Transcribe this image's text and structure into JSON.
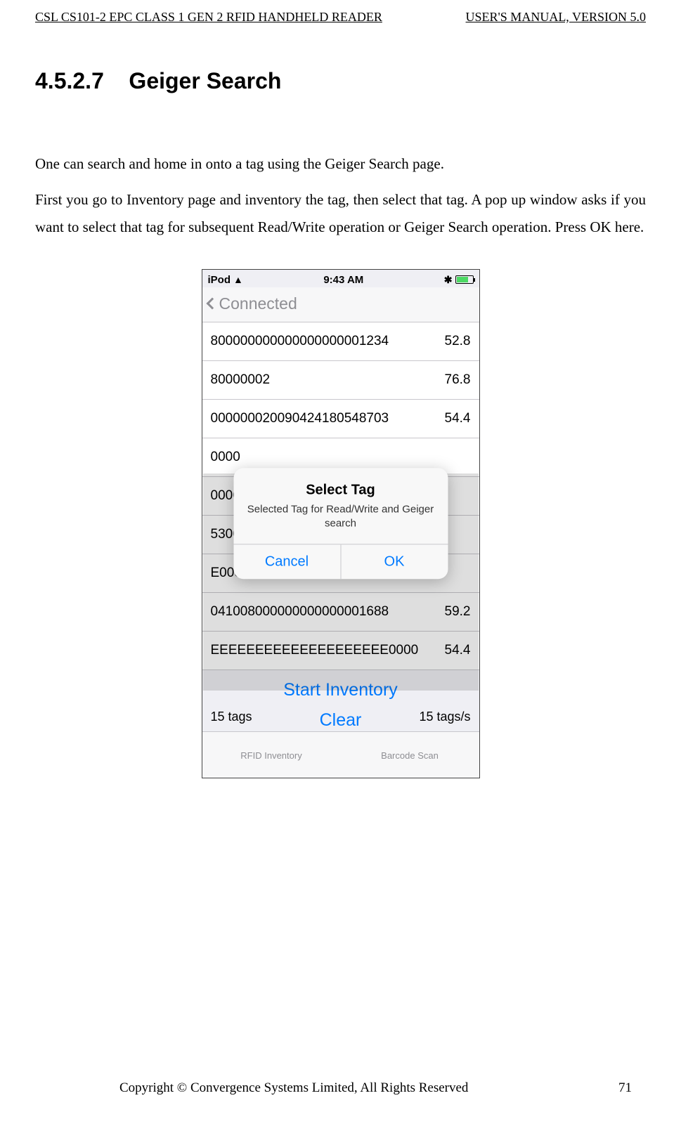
{
  "doc_header": {
    "left": "CSL CS101-2 EPC CLASS 1 GEN 2 RFID HANDHELD READER",
    "right": "USER'S  MANUAL,  VERSION  5.0"
  },
  "section": {
    "number": "4.5.2.7",
    "title": "Geiger Search"
  },
  "paragraphs": {
    "p1": "One can search and home in onto a tag using the Geiger Search page.",
    "p2": "First you go to Inventory page and inventory the tag, then select that tag.   A pop up window asks if you want to select that tag for subsequent Read/Write operation or Geiger Search operation.   Press OK here."
  },
  "screenshot": {
    "status": {
      "device": "iPod",
      "time": "9:43 AM"
    },
    "nav": {
      "back": "Connected"
    },
    "rows": [
      {
        "epc": "800000000000000000001234",
        "val": "52.8"
      },
      {
        "epc": "80000002",
        "val": "76.8"
      },
      {
        "epc": "000000020090424180548703",
        "val": "54.4"
      },
      {
        "epc": "0000",
        "val": ""
      },
      {
        "epc": "0000",
        "val": ""
      },
      {
        "epc": "5300",
        "val": ""
      },
      {
        "epc": "E000",
        "val": ""
      },
      {
        "epc": "041008000000000000001688",
        "val": "59.2"
      },
      {
        "epc": "EEEEEEEEEEEEEEEEEEEE0000",
        "val": "54.4"
      }
    ],
    "actions": {
      "start": "Start Inventory",
      "clear": "Clear"
    },
    "stats": {
      "left": "15 tags",
      "right": "15 tags/s"
    },
    "tabs": {
      "rfid": "RFID Inventory",
      "barcode": "Barcode Scan"
    },
    "alert": {
      "title": "Select Tag",
      "message": "Selected Tag for Read/Write and Geiger search",
      "cancel": "Cancel",
      "ok": "OK"
    }
  },
  "footer": {
    "copyright": "Copyright © Convergence Systems Limited, All Rights Reserved",
    "page": "71"
  }
}
